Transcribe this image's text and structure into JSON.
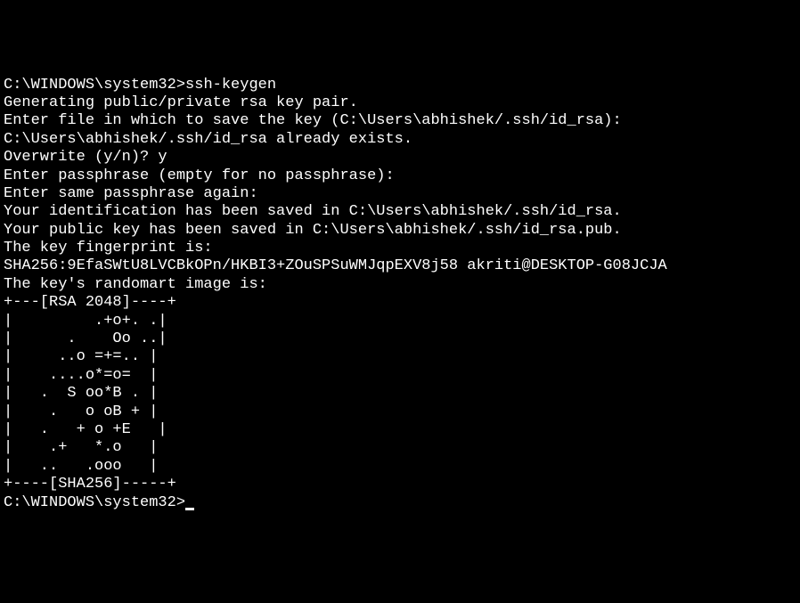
{
  "terminal": {
    "prompt1": "C:\\WINDOWS\\system32>",
    "command": "ssh-keygen",
    "lines": [
      "Generating public/private rsa key pair.",
      "Enter file in which to save the key (C:\\Users\\abhishek/.ssh/id_rsa):",
      "C:\\Users\\abhishek/.ssh/id_rsa already exists.",
      "Overwrite (y/n)? y",
      "Enter passphrase (empty for no passphrase):",
      "Enter same passphrase again:",
      "Your identification has been saved in C:\\Users\\abhishek/.ssh/id_rsa.",
      "Your public key has been saved in C:\\Users\\abhishek/.ssh/id_rsa.pub.",
      "The key fingerprint is:",
      "SHA256:9EfaSWtU8LVCBkOPn/HKBI3+ZOuSPSuWMJqpEXV8j58 akriti@DESKTOP-G08JCJA",
      "The key's randomart image is:",
      "+---[RSA 2048]----+",
      "|         .+o+. .|",
      "|      .    Oo ..|",
      "|     ..o =+=.. |",
      "|    ....o*=o=  |",
      "|   .  S oo*B . |",
      "|    .   o oB + |",
      "|   .   + o +E   |",
      "|    .+   *.o   |",
      "|   ..   .ooo   |",
      "+----[SHA256]-----+",
      ""
    ],
    "prompt2": "C:\\WINDOWS\\system32>"
  }
}
